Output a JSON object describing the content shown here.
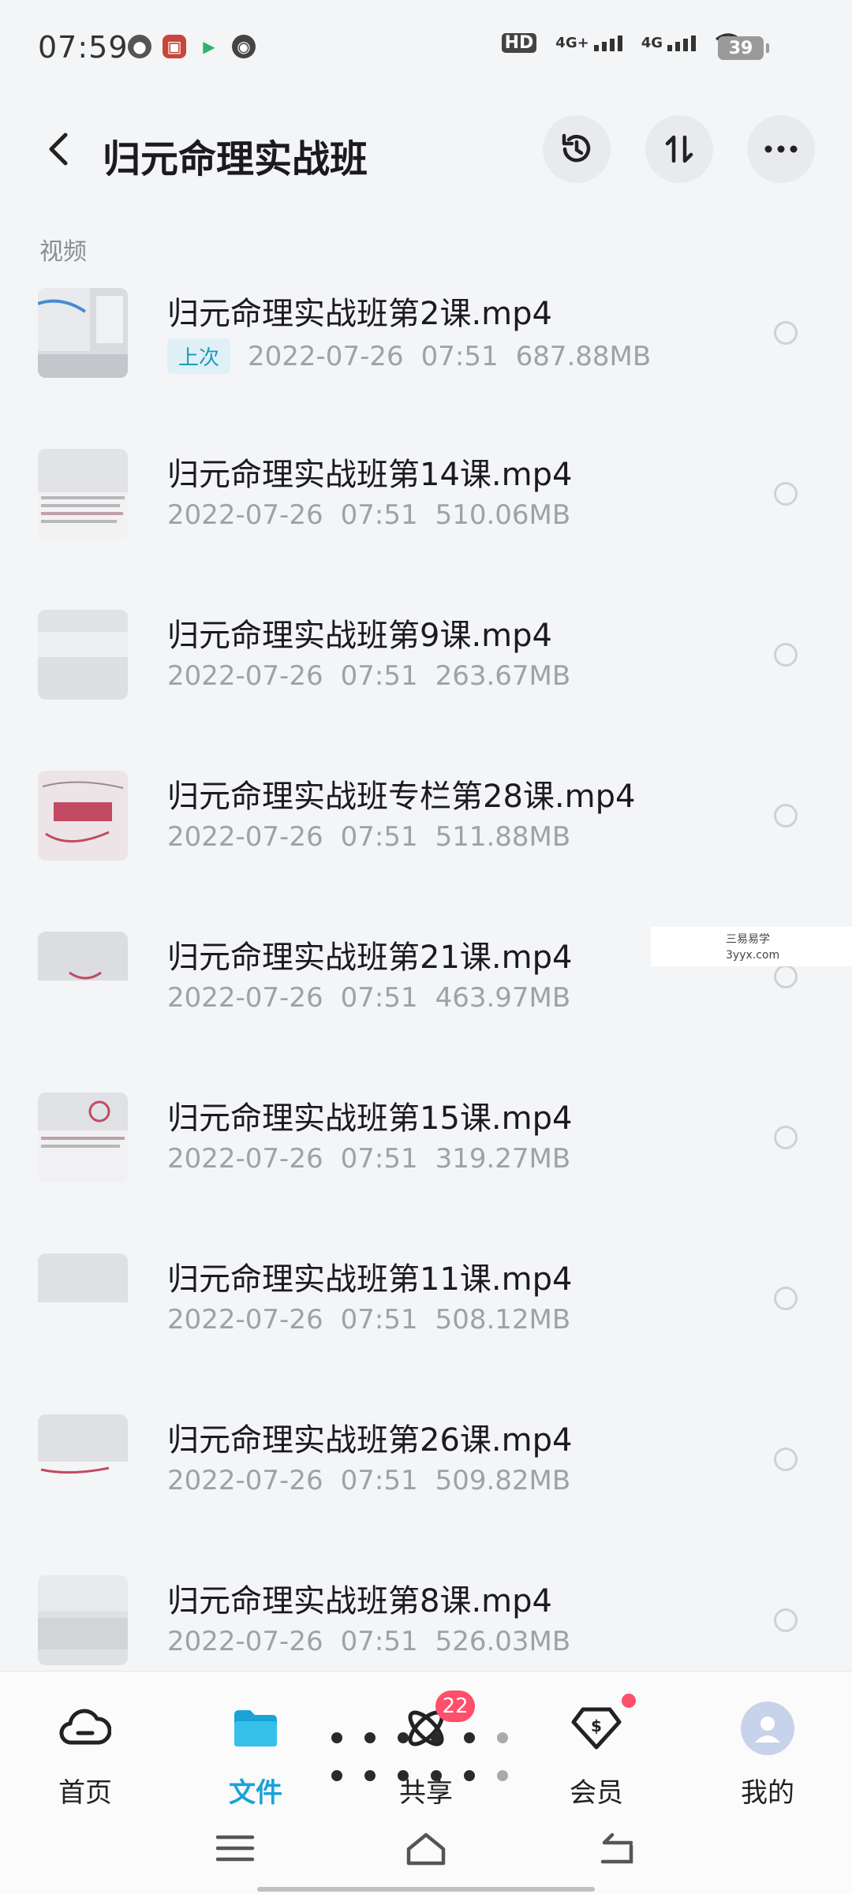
{
  "status": {
    "time": "07:59",
    "network_1": "4G+",
    "network_2": "4G",
    "hd": "HD",
    "battery": "39"
  },
  "header": {
    "title": "归元命理实战班"
  },
  "section_label": "视频",
  "files": [
    {
      "name": "归元命理实战班第2课.mp4",
      "tag": "上次",
      "date": "2022-07-26",
      "time": "07:51",
      "size": "687.88MB"
    },
    {
      "name": "归元命理实战班第14课.mp4",
      "tag": "",
      "date": "2022-07-26",
      "time": "07:51",
      "size": "510.06MB"
    },
    {
      "name": "归元命理实战班第9课.mp4",
      "tag": "",
      "date": "2022-07-26",
      "time": "07:51",
      "size": "263.67MB"
    },
    {
      "name": "归元命理实战班专栏第28课.mp4",
      "tag": "",
      "date": "2022-07-26",
      "time": "07:51",
      "size": "511.88MB"
    },
    {
      "name": "归元命理实战班第21课.mp4",
      "tag": "",
      "date": "2022-07-26",
      "time": "07:51",
      "size": "463.97MB"
    },
    {
      "name": "归元命理实战班第15课.mp4",
      "tag": "",
      "date": "2022-07-26",
      "time": "07:51",
      "size": "319.27MB"
    },
    {
      "name": "归元命理实战班第11课.mp4",
      "tag": "",
      "date": "2022-07-26",
      "time": "07:51",
      "size": "508.12MB"
    },
    {
      "name": "归元命理实战班第26课.mp4",
      "tag": "",
      "date": "2022-07-26",
      "time": "07:51",
      "size": "509.82MB"
    },
    {
      "name": "归元命理实战班第8课.mp4",
      "tag": "",
      "date": "2022-07-26",
      "time": "07:51",
      "size": "526.03MB"
    }
  ],
  "watermark": {
    "line1": "三易易学",
    "line2": "3yyx.com"
  },
  "nav": {
    "home": "首页",
    "files": "文件",
    "share": "共享",
    "share_badge": "22",
    "member": "会员",
    "mine": "我的"
  },
  "colors": {
    "accent": "#1aa3d6",
    "badge": "#ff4f6b"
  }
}
